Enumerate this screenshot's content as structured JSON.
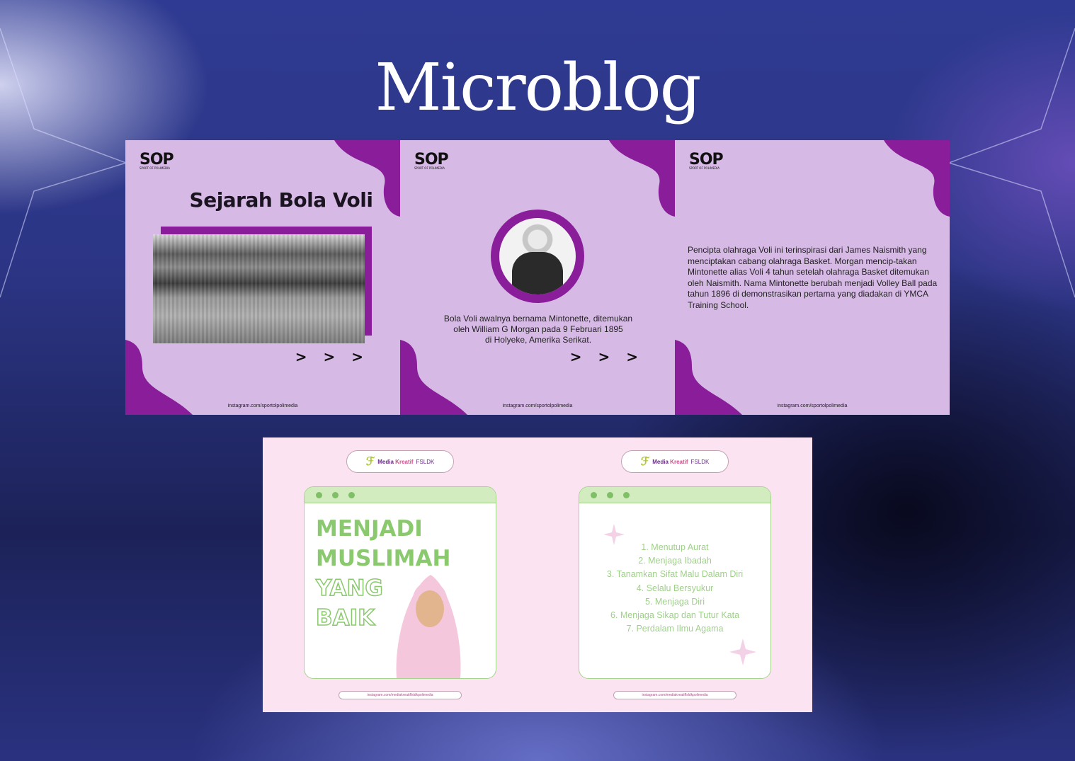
{
  "page": {
    "title": "Microblog"
  },
  "slides_top": [
    {
      "logo": "SOP",
      "title": "Sejarah Bola Voli",
      "image_alt": "volleyball match photo",
      "arrows": "> > >",
      "handle": "instagram.com/sportolpolimedia"
    },
    {
      "logo": "SOP",
      "image_alt": "William G Morgan portrait",
      "caption_lines": [
        "Bola Voli awalnya bernama Mintonette, ditemukan",
        "oleh William G Morgan pada 9 Februari 1895",
        "di Holyeke, Amerika Serikat."
      ],
      "arrows": "> > >",
      "handle": "instagram.com/sportolpolimedia"
    },
    {
      "logo": "SOP",
      "paragraph": "Pencipta olahraga Voli ini terinspirasi dari James Naismith yang menciptakan cabang olahraga Basket. Morgan mencip-takan Mintonette alias Voli 4 tahun setelah olahraga Basket ditemukan oleh Naismith. Nama Mintonette berubah menjadi Volley Ball pada tahun 1896 di demonstrasikan pertama yang diadakan di YMCA Training School.",
      "handle": "instagram.com/sportolpolimedia"
    }
  ],
  "slides_bottom": [
    {
      "badge": {
        "brand": "Media",
        "brand_accent": "Kreatif",
        "sub": "FSLDK"
      },
      "title_lines": [
        "MENJADI",
        "MUSLIMAH",
        "YANG",
        "BAIK"
      ],
      "footer": "instagram.com/mediakreatiffsldkpolimedia"
    },
    {
      "badge": {
        "brand": "Media",
        "brand_accent": "Kreatif",
        "sub": "FSLDK"
      },
      "list": [
        "1. Menutup Aurat",
        "2. Menjaga Ibadah",
        "3. Tanamkan Sifat Malu Dalam Diri",
        "4. Selalu Bersyukur",
        "5. Menjaga Diri",
        "6. Menjaga Sikap dan Tutur Kata",
        "7. Perdalam Ilmu Agama"
      ],
      "footer": "instagram.com/mediakreatiffsldkpolimedia"
    }
  ],
  "colors": {
    "purple_shape": "#8a1d9a",
    "slide_bg": "#d7b9e6",
    "pink_bg": "#fbe3f1",
    "green_accent": "#8bc96f"
  }
}
